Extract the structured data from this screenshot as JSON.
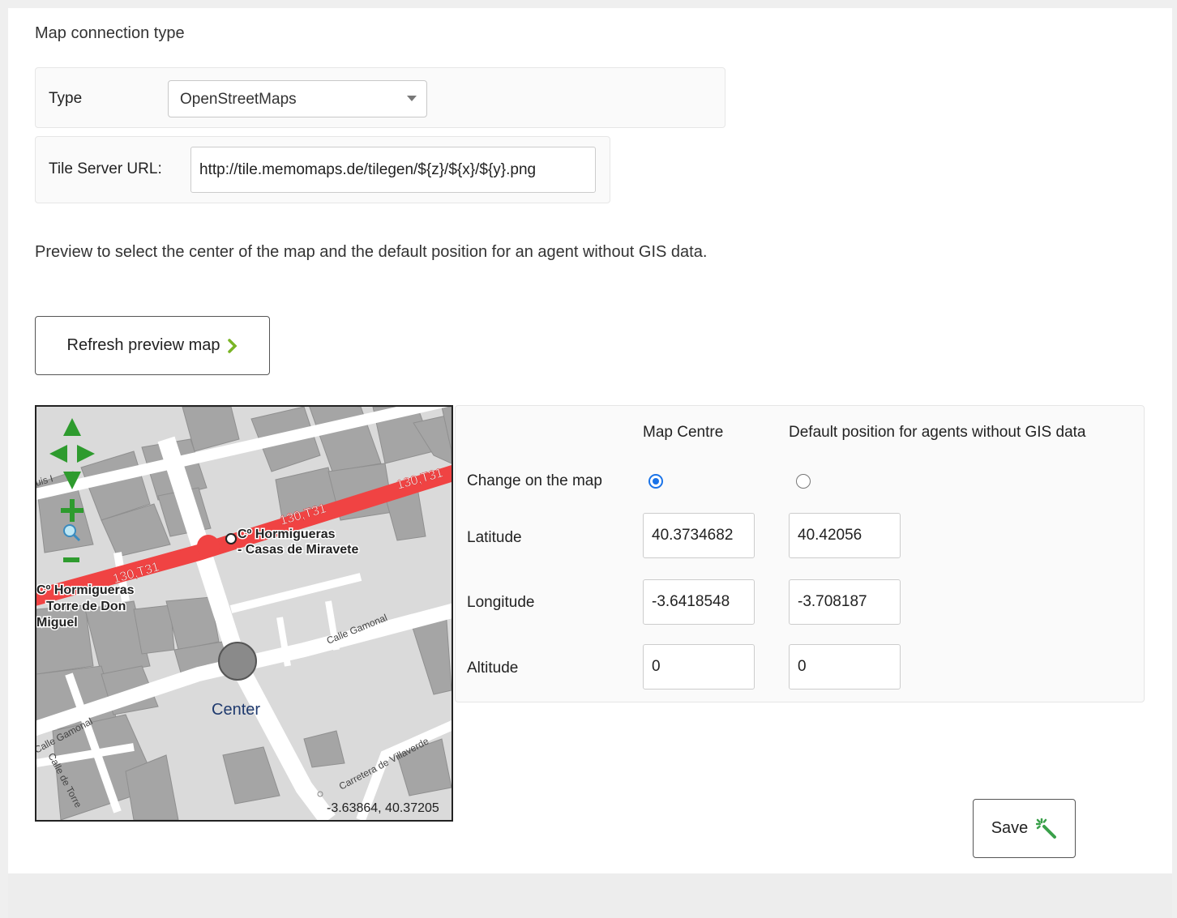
{
  "section": {
    "title": "Map connection type"
  },
  "type_row": {
    "label": "Type",
    "selected": "OpenStreetMaps"
  },
  "tile_row": {
    "label": "Tile Server URL:",
    "value": "http://tile.memomaps.de/tilegen/${z}/${x}/${y}.png"
  },
  "preview": {
    "text": "Preview to select the center of the map and the default position for an agent without GIS data.",
    "refresh_label": "Refresh preview map"
  },
  "map": {
    "labels": {
      "route1": "130,T31",
      "route2": "130,T31",
      "route3": "130,T31",
      "stop1_line1": "Cº Hormigueras",
      "stop1_line2": "- Casas de Miravete",
      "stop2_line1": "Cº Hormigueras",
      "stop2_line2": "Torre de Don",
      "stop2_line3": "Miguel",
      "street1": "Calle Gamonal",
      "street2": "Calle Gamonal",
      "street3": "Carretera de Villaverde",
      "street4": "Calle de Torre",
      "partial": "uis I",
      "center": "Center",
      "coords": "-3.63864, 40.37205"
    }
  },
  "coords_table": {
    "col_centre": "Map Centre",
    "col_default": "Default position for agents without GIS data",
    "row_change": "Change on the map",
    "row_lat": "Latitude",
    "row_lon": "Longitude",
    "row_alt": "Altitude",
    "centre": {
      "lat": "40.3734682",
      "lon": "-3.6418548",
      "alt": "0"
    },
    "default": {
      "lat": "40.42056",
      "lon": "-3.708187",
      "alt": "0"
    }
  },
  "save_label": "Save",
  "colors": {
    "route": "#f04343",
    "accent": "#1a73e8",
    "nav_green": "#2e9b2e"
  }
}
